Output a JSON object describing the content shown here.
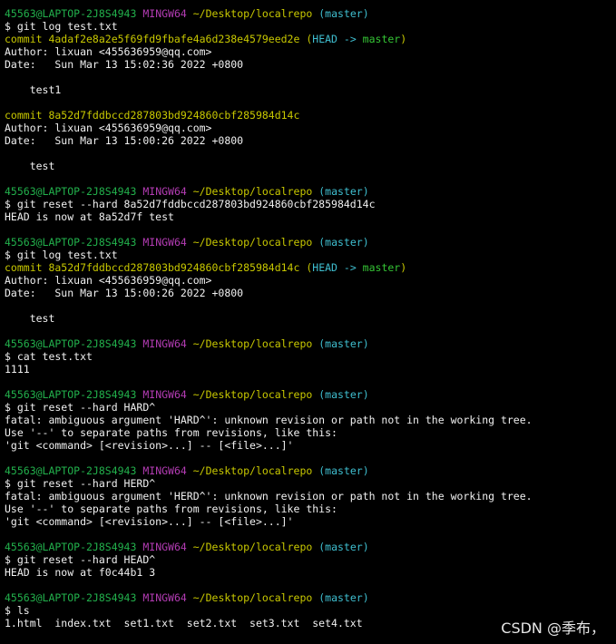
{
  "colors": {
    "background": "#000000",
    "user_host": "#22b14c",
    "shell": "#b33cb3",
    "path": "#c8c800",
    "branch": "#3fbfd0",
    "commit_hash": "#c8c800",
    "head_ref": "#3fbfd0",
    "ref_branch": "#35c535",
    "text": "#f0f0f0"
  },
  "prompt": {
    "user_host": "45563@LAPTOP-2J8S4943",
    "shell": "MINGW64",
    "path": "~/Desktop/localrepo",
    "branch": "(master)"
  },
  "blocks": [
    {
      "command": "$ git log test.txt",
      "output": [
        {
          "type": "commit",
          "text": "commit 4adaf2e8a2e5f69fd9fbafe4a6d238e4579eed2e",
          "ref_open": " (",
          "head": "HEAD ->",
          "ref_branch": " master",
          "ref_close": ")"
        },
        {
          "type": "plain",
          "text": "Author: lixuan <455636959@qq.com>"
        },
        {
          "type": "plain",
          "text": "Date:   Sun Mar 13 15:02:36 2022 +0800"
        },
        {
          "type": "plain",
          "text": ""
        },
        {
          "type": "plain",
          "text": "    test1"
        },
        {
          "type": "plain",
          "text": ""
        },
        {
          "type": "commit",
          "text": "commit 8a52d7fddbccd287803bd924860cbf285984d14c"
        },
        {
          "type": "plain",
          "text": "Author: lixuan <455636959@qq.com>"
        },
        {
          "type": "plain",
          "text": "Date:   Sun Mar 13 15:00:26 2022 +0800"
        },
        {
          "type": "plain",
          "text": ""
        },
        {
          "type": "plain",
          "text": "    test"
        }
      ]
    },
    {
      "command": "$ git reset --hard 8a52d7fddbccd287803bd924860cbf285984d14c",
      "output": [
        {
          "type": "plain",
          "text": "HEAD is now at 8a52d7f test"
        }
      ]
    },
    {
      "command": "$ git log test.txt",
      "output": [
        {
          "type": "commit",
          "text": "commit 8a52d7fddbccd287803bd924860cbf285984d14c",
          "ref_open": " (",
          "head": "HEAD ->",
          "ref_branch": " master",
          "ref_close": ")"
        },
        {
          "type": "plain",
          "text": "Author: lixuan <455636959@qq.com>"
        },
        {
          "type": "plain",
          "text": "Date:   Sun Mar 13 15:00:26 2022 +0800"
        },
        {
          "type": "plain",
          "text": ""
        },
        {
          "type": "plain",
          "text": "    test"
        }
      ]
    },
    {
      "command": "$ cat test.txt",
      "output": [
        {
          "type": "plain",
          "text": "1111"
        }
      ]
    },
    {
      "command": "$ git reset --hard HARD^",
      "output": [
        {
          "type": "plain",
          "text": "fatal: ambiguous argument 'HARD^': unknown revision or path not in the working tree."
        },
        {
          "type": "plain",
          "text": "Use '--' to separate paths from revisions, like this:"
        },
        {
          "type": "plain",
          "text": "'git <command> [<revision>...] -- [<file>...]'"
        }
      ]
    },
    {
      "command": "$ git reset --hard HERD^",
      "output": [
        {
          "type": "plain",
          "text": "fatal: ambiguous argument 'HERD^': unknown revision or path not in the working tree."
        },
        {
          "type": "plain",
          "text": "Use '--' to separate paths from revisions, like this:"
        },
        {
          "type": "plain",
          "text": "'git <command> [<revision>...] -- [<file>...]'"
        }
      ]
    },
    {
      "command": "$ git reset --hard HEAD^",
      "output": [
        {
          "type": "plain",
          "text": "HEAD is now at f0c44b1 3"
        }
      ]
    },
    {
      "command": "$ ls",
      "output": [
        {
          "type": "plain",
          "text": "1.html  index.txt  set1.txt  set2.txt  set3.txt  set4.txt"
        }
      ]
    }
  ],
  "watermark": "CSDN @季布，"
}
